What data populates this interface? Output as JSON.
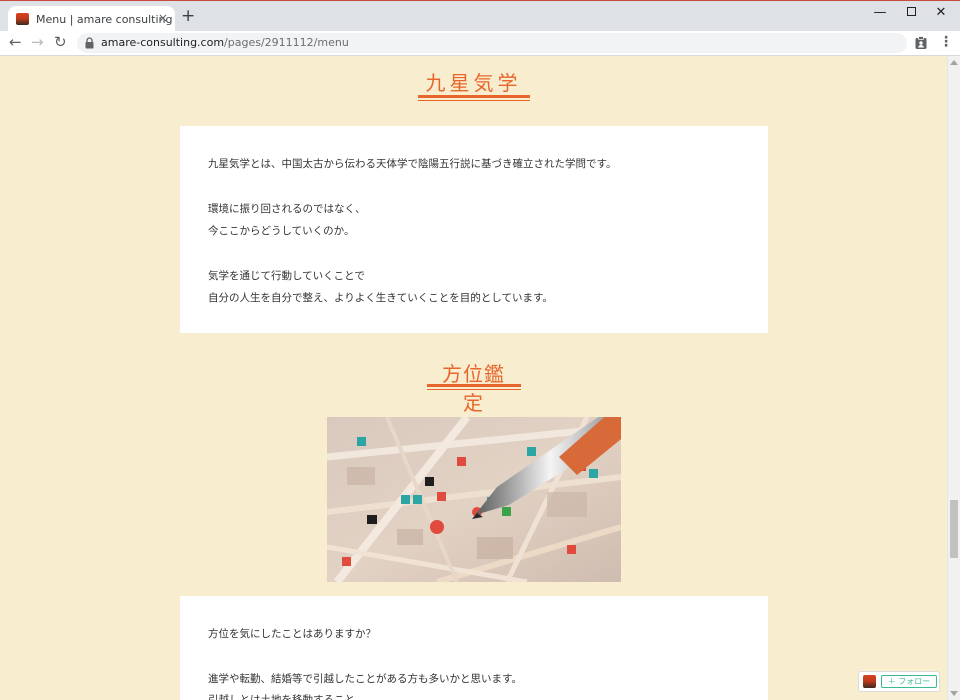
{
  "browser": {
    "tab_title": "Menu | amare consulting",
    "tab_close": "×",
    "new_tab": "+",
    "url_domain": "amare-consulting.com",
    "url_path": "/pages/2911112/menu",
    "window": {
      "minimize": "—",
      "close": "✕"
    },
    "nav": {
      "back": "←",
      "forward": "→",
      "reload": "↻"
    },
    "menu": "⋮"
  },
  "sections": {
    "kyusei": {
      "heading": "九星気学",
      "lines": [
        "九星気学とは、中国太古から伝わる天体学で陰陽五行説に基づき確立された学問です。",
        "環境に振り回されるのではなく、",
        "今ここからどうしていくのか。",
        "気学を通じて行動していくことで",
        "自分の人生を自分で整え、よりよく生きていくことを目的としています。"
      ]
    },
    "houi": {
      "heading": "方位鑑定",
      "image_alt": "map-with-pen-photo",
      "lines": [
        "方位を気にしたことはありますか？",
        "進学や転勤、結婚等で引越したことがある方も多いかと思います。",
        "引越しとは土地を移動すること"
      ]
    }
  },
  "follow_widget": {
    "label": "＋ フォロー"
  },
  "colors": {
    "accent": "#e8652b",
    "background": "#f8eecf",
    "follow_green": "#3cb98d"
  }
}
